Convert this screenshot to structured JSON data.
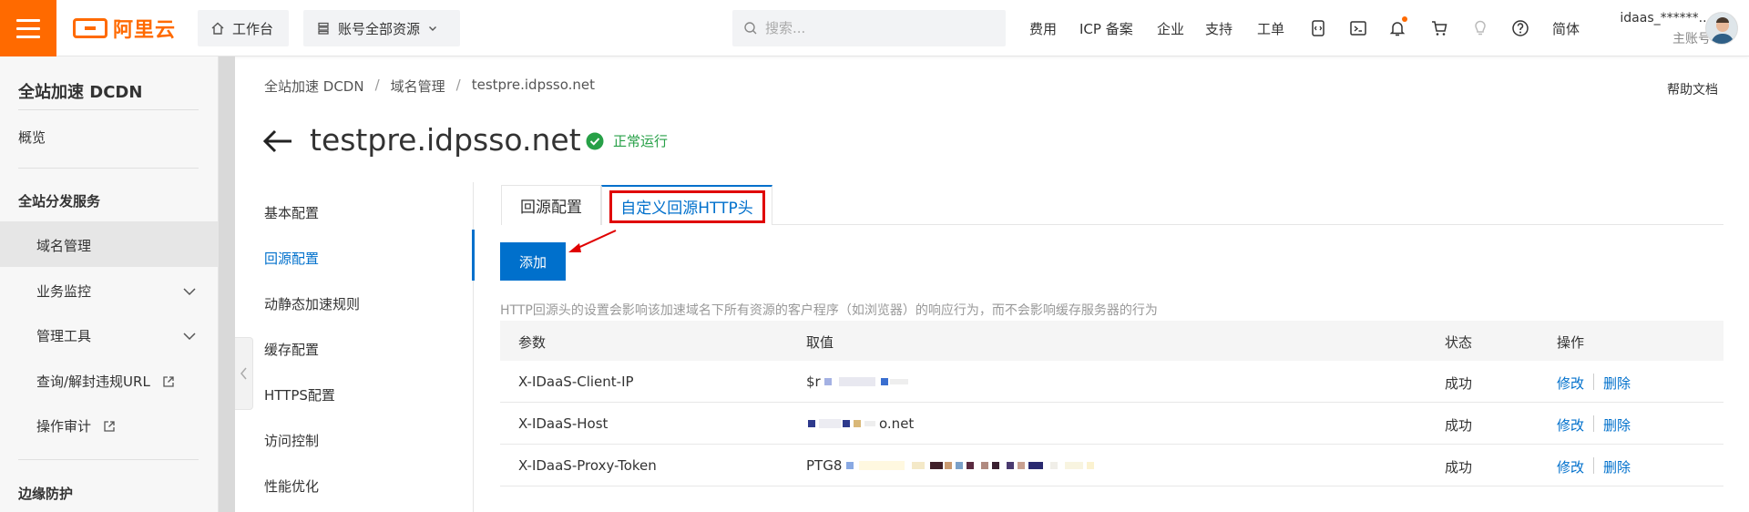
{
  "topbar": {
    "brand": "阿里云",
    "workbench": "工作台",
    "resources": "账号全部资源",
    "search_placeholder": "搜索...",
    "nav": [
      "费用",
      "ICP 备案",
      "企业",
      "支持",
      "工单"
    ],
    "lang": "简体",
    "account_name": "idaas_******...",
    "account_role": "主账号"
  },
  "sidebar": {
    "title": "全站加速 DCDN",
    "overview": "概览",
    "section_distribution": "全站分发服务",
    "domain_mgmt": "域名管理",
    "monitoring": "业务监控",
    "tools": "管理工具",
    "query_unblock": "查询/解封违规URL",
    "audit": "操作审计",
    "section_edge": "边缘防护"
  },
  "breadcrumb": [
    "全站加速 DCDN",
    "域名管理",
    "testpre.idpsso.net"
  ],
  "help": "帮助文档",
  "page": {
    "title": "testpre.idpsso.net",
    "status": "正常运行"
  },
  "subnav": [
    "基本配置",
    "回源配置",
    "动静态加速规则",
    "缓存配置",
    "HTTPS配置",
    "访问控制",
    "性能优化"
  ],
  "tabs": [
    "回源配置",
    "自定义回源HTTP头"
  ],
  "add_button": "添加",
  "hint": "HTTP回源头的设置会影响该加速域名下所有资源的客户程序（如浏览器）的响应行为，而不会影响缓存服务器的行为",
  "table": {
    "headers": [
      "参数",
      "取值",
      "状态",
      "操作"
    ],
    "rows": [
      {
        "param": "X-IDaaS-Client-IP",
        "value": "$r",
        "status": "成功",
        "edit": "修改",
        "delete": "删除"
      },
      {
        "param": "X-IDaaS-Host",
        "value": "o.net",
        "status": "成功",
        "edit": "修改",
        "delete": "删除"
      },
      {
        "param": "X-IDaaS-Proxy-Token",
        "value": "PTG8",
        "status": "成功",
        "edit": "修改",
        "delete": "删除"
      }
    ]
  }
}
